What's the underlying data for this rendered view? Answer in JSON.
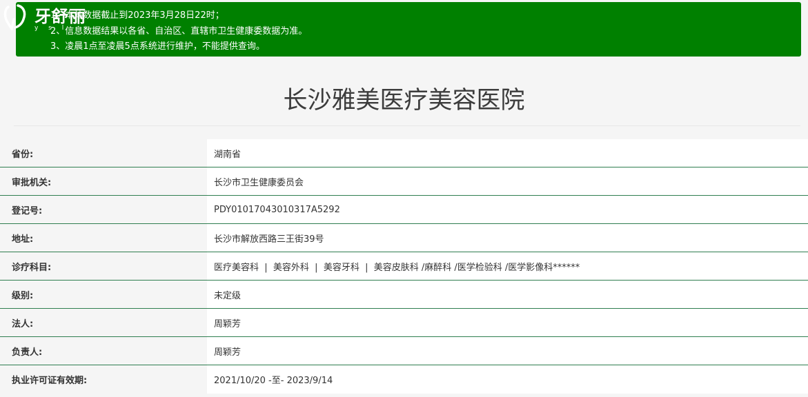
{
  "logo": {
    "name": "牙舒丽",
    "tagline": "y s l"
  },
  "notice": {
    "lines": [
      "1、本站数据截止到2023年3月28日22时；",
      "2、信息数据结果以各省、自治区、直辖市卫生健康委数据为准。",
      "3、凌晨1点至凌晨5点系统进行维护，不能提供查询。"
    ]
  },
  "page": {
    "title": "长沙雅美医疗美容医院"
  },
  "info": {
    "rows": [
      {
        "label": "省份:",
        "value": "湖南省"
      },
      {
        "label": "审批机关:",
        "value": "长沙市卫生健康委员会"
      },
      {
        "label": "登记号:",
        "value": "PDY01017043010317A5292"
      },
      {
        "label": "地址:",
        "value": "长沙市解放西路三王街39号"
      },
      {
        "label": "诊疗科目:",
        "value": "医疗美容科  |  美容外科  |  美容牙科  |  美容皮肤科 /麻醉科 /医学检验科 /医学影像科******"
      },
      {
        "label": "级别:",
        "value": "未定级"
      },
      {
        "label": "法人:",
        "value": "周颖芳"
      },
      {
        "label": "负责人:",
        "value": "周颖芳"
      },
      {
        "label": "执业许可证有效期:",
        "value": "2021/10/20 -至- 2023/9/14"
      }
    ]
  },
  "colors": {
    "notice_bg": "#008000",
    "row_divider": "#2e7d4f",
    "page_bg": "#f5f5f5"
  }
}
